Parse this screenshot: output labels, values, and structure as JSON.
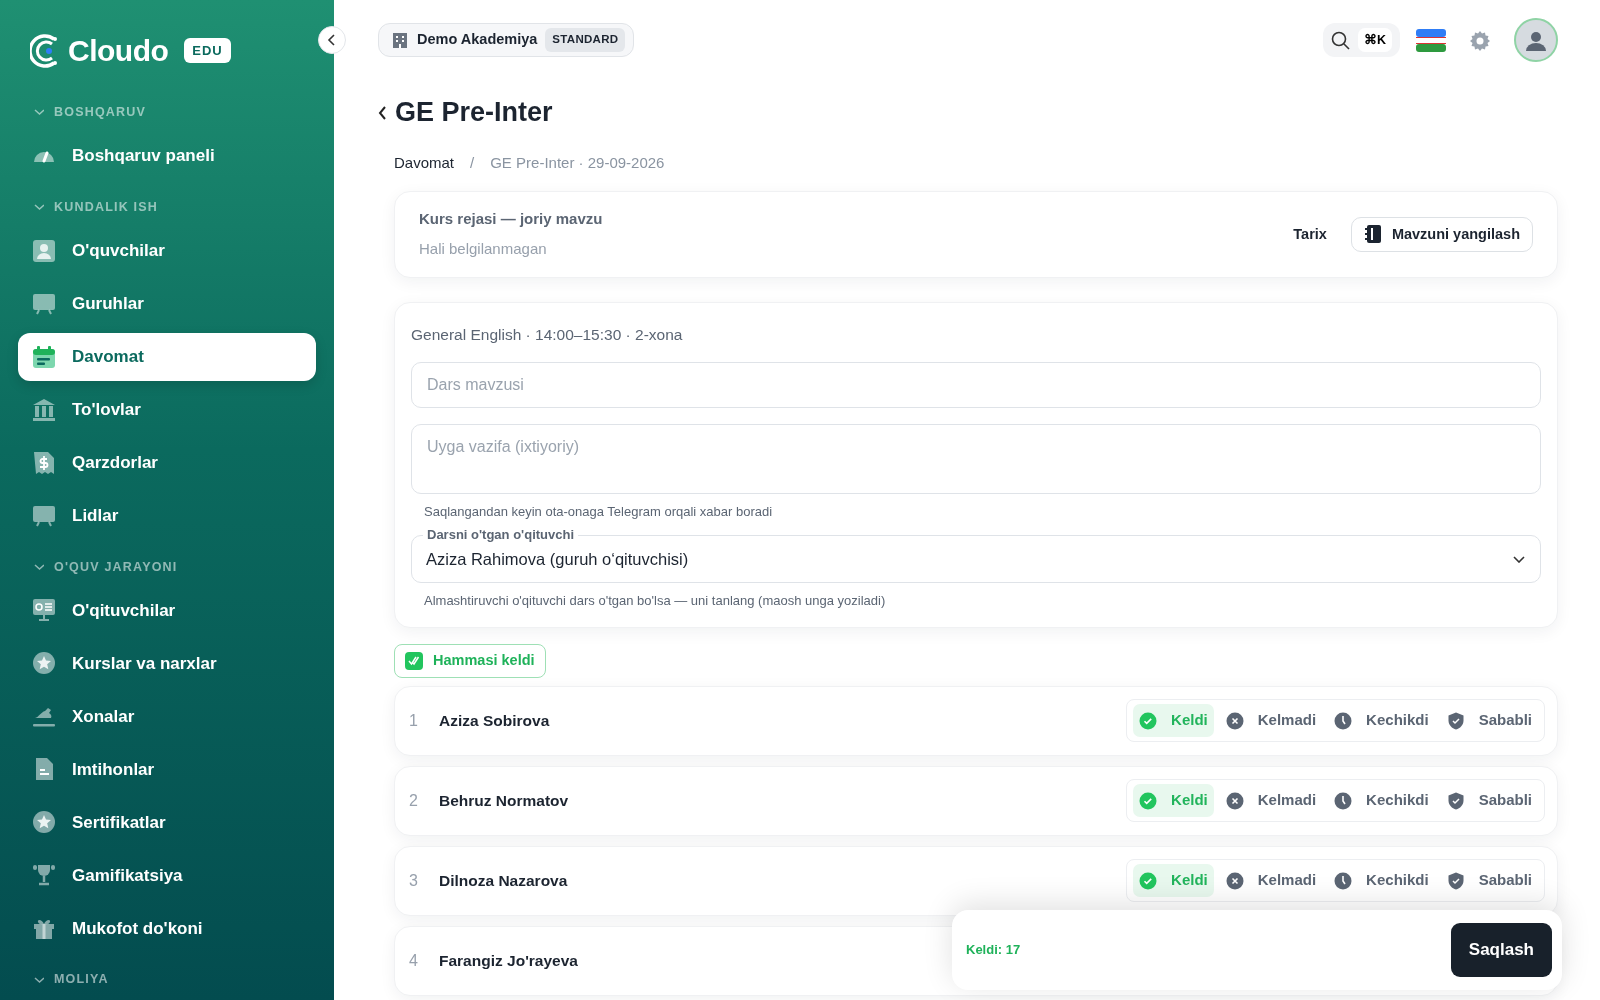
{
  "sidebar": {
    "logo": "Cloudo",
    "edition": "EDU",
    "sections": [
      {
        "title": "BOSHQARUV",
        "expanded": true,
        "items": [
          {
            "label": "Boshqaruv paneli",
            "selected": false
          }
        ]
      },
      {
        "title": "KUNDALIK ISH",
        "expanded": true,
        "items": [
          {
            "label": "O'quvchilar",
            "selected": false
          },
          {
            "label": "Guruhlar",
            "selected": false
          },
          {
            "label": "Davomat",
            "selected": true
          },
          {
            "label": "To'lovlar",
            "selected": false
          },
          {
            "label": "Qarzdorlar",
            "selected": false
          },
          {
            "label": "Lidlar",
            "selected": false
          }
        ]
      },
      {
        "title": "O'QUV JARAYONI",
        "expanded": true,
        "items": [
          {
            "label": "O'qituvchilar",
            "selected": false
          },
          {
            "label": "Kurslar va narxlar",
            "selected": false
          },
          {
            "label": "Xonalar",
            "selected": false
          },
          {
            "label": "Imtihonlar",
            "selected": false
          },
          {
            "label": "Sertifikatlar",
            "selected": false
          },
          {
            "label": "Gamifikatsiya",
            "selected": false
          },
          {
            "label": "Mukofot do'koni",
            "selected": false
          }
        ]
      },
      {
        "title": "MOLIYA",
        "expanded": true
      }
    ]
  },
  "topbar": {
    "organization": "Demo Akademiya",
    "plan": "STANDARD",
    "shortcut": "⌘K"
  },
  "page": {
    "title": "GE Pre-Inter",
    "breadcrumb": [
      "Davomat",
      "GE Pre-Inter · 29-09-2026"
    ],
    "breadcrumb_separator": "/"
  },
  "course_plan": {
    "title": "Kurs rejasi — joriy mavzu",
    "value": "Hali belgilanmagan",
    "history_link": "Tarix",
    "update_button": "Mavzuni yangilash"
  },
  "lesson": {
    "meta": "General English · 14:00–15:30 · 2-xona",
    "topic_placeholder": "Dars mavzusi",
    "homework_placeholder": "Uyga vazifa (ixtiyoriy)",
    "homework_hint": "Saqlangandan keyin ota-onaga Telegram orqali xabar boradi",
    "teacher_label": "Darsni o'tgan o'qituvchi",
    "teacher_value": "Aziza Rahimova (guruh o‘qituvchisi)",
    "teacher_hint": "Almashtiruvchi o'qituvchi dars o'tgan bo'lsa — uni tanlang (maosh unga yoziladi)"
  },
  "all_present": {
    "label": "Hammasi keldi",
    "checked": true
  },
  "students": [
    {
      "number": "1",
      "name": "Aziza Sobirova",
      "options": [
        {
          "kind": "present",
          "label": "Keldi",
          "selected": true
        },
        {
          "kind": "absent",
          "label": "Kelmadi",
          "selected": false
        },
        {
          "kind": "late",
          "label": "Kechikdi",
          "selected": false
        },
        {
          "kind": "excused",
          "label": "Sababli",
          "selected": false
        }
      ]
    },
    {
      "number": "2",
      "name": "Behruz Normatov",
      "options": [
        {
          "kind": "present",
          "label": "Keldi",
          "selected": true
        },
        {
          "kind": "absent",
          "label": "Kelmadi",
          "selected": false
        },
        {
          "kind": "late",
          "label": "Kechikdi",
          "selected": false
        },
        {
          "kind": "excused",
          "label": "Sababli",
          "selected": false
        }
      ]
    },
    {
      "number": "3",
      "name": "Dilnoza Nazarova",
      "options": [
        {
          "kind": "present",
          "label": "Keldi",
          "selected": true
        },
        {
          "kind": "absent",
          "label": "Kelmadi",
          "selected": false
        },
        {
          "kind": "late",
          "label": "Kechikdi",
          "selected": false
        },
        {
          "kind": "excused",
          "label": "Sababli",
          "selected": false
        }
      ]
    },
    {
      "number": "4",
      "name": "Farangiz Jo'rayeva"
    }
  ],
  "save_bar": {
    "summary": "Keldi: 17",
    "save_button": "Saqlash"
  }
}
